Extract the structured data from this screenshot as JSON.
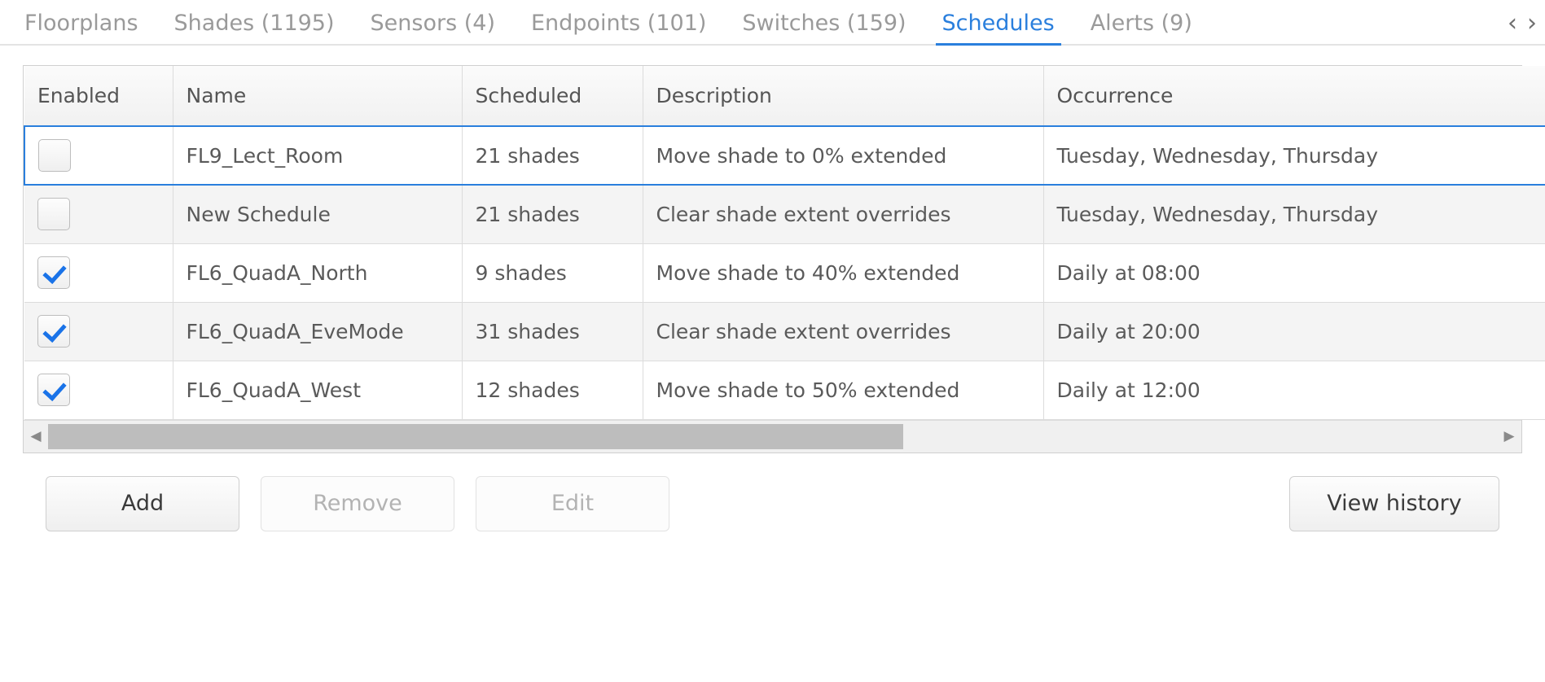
{
  "theme": {
    "accent": "#2a7fdd",
    "check_color": "#1a73e8",
    "text": "#5a5a5a",
    "muted": "#9a9a9a",
    "row_alt_bg": "#f4f4f4"
  },
  "tabs": {
    "items": [
      {
        "label": "Floorplans",
        "active": false
      },
      {
        "label": "Shades (1195)",
        "active": false
      },
      {
        "label": "Sensors (4)",
        "active": false
      },
      {
        "label": "Endpoints (101)",
        "active": false
      },
      {
        "label": "Switches (159)",
        "active": false
      },
      {
        "label": "Schedules",
        "active": true
      },
      {
        "label": "Alerts (9)",
        "active": false
      }
    ],
    "prev_icon": "‹",
    "next_icon": "›"
  },
  "table": {
    "columns": [
      "Enabled",
      "Name",
      "Scheduled",
      "Description",
      "Occurrence"
    ],
    "rows": [
      {
        "enabled": false,
        "name": "FL9_Lect_Room",
        "scheduled": "21 shades",
        "description": "Move shade to 0% extended",
        "occurrence": "Tuesday, Wednesday, Thursday",
        "selected": true
      },
      {
        "enabled": false,
        "name": "New Schedule",
        "scheduled": "21 shades",
        "description": "Clear shade extent overrides",
        "occurrence": "Tuesday, Wednesday, Thursday",
        "selected": false
      },
      {
        "enabled": true,
        "name": "FL6_QuadA_North",
        "scheduled": "9 shades",
        "description": "Move shade to 40% extended",
        "occurrence": "Daily at 08:00",
        "selected": false
      },
      {
        "enabled": true,
        "name": "FL6_QuadA_EveMode",
        "scheduled": "31 shades",
        "description": "Clear shade extent overrides",
        "occurrence": "Daily at 20:00",
        "selected": false
      },
      {
        "enabled": true,
        "name": "FL6_QuadA_West",
        "scheduled": "12 shades",
        "description": "Move shade to 50% extended",
        "occurrence": "Daily at 12:00",
        "selected": false
      }
    ]
  },
  "scrollbar": {
    "left_arrow": "◀",
    "right_arrow": "▶",
    "thumb_percent": 59
  },
  "actions": {
    "add": {
      "label": "Add",
      "enabled": true
    },
    "remove": {
      "label": "Remove",
      "enabled": false
    },
    "edit": {
      "label": "Edit",
      "enabled": false
    },
    "view_history": {
      "label": "View history",
      "enabled": true
    }
  }
}
